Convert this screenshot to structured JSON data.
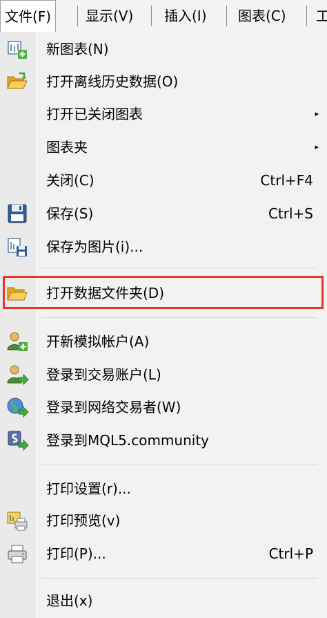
{
  "menubar": {
    "items": [
      "文件(F)",
      "显示(V)",
      "插入(I)",
      "图表(C)",
      "工"
    ]
  },
  "menu": {
    "items": [
      {
        "label": "新图表(N)",
        "icon": "new-chart-icon"
      },
      {
        "label": "打开离线历史数据(O)",
        "icon": "open-folder-icon"
      },
      {
        "label": "打开已关闭图表",
        "submenu": "▸"
      },
      {
        "label": "图表夹",
        "submenu": "▸"
      },
      {
        "label": "关闭(C)",
        "shortcut": "Ctrl+F4"
      },
      {
        "label": "保存(S)",
        "shortcut": "Ctrl+S",
        "icon": "floppy-disk-icon"
      },
      {
        "label": "保存为图片(i)...",
        "icon": "save-picture-icon"
      },
      {
        "label": "打开数据文件夹(D)",
        "icon": "folder-icon",
        "highlighted": true
      },
      {
        "label": "开新模拟帐户(A)",
        "icon": "user-add-icon"
      },
      {
        "label": "登录到交易账户(L)",
        "icon": "user-login-icon"
      },
      {
        "label": "登录到网络交易者(W)",
        "icon": "globe-login-icon"
      },
      {
        "label": "登录到MQL5.community",
        "icon": "mql5-login-icon"
      },
      {
        "label": "打印设置(r)..."
      },
      {
        "label": "打印预览(v)",
        "icon": "print-preview-icon"
      },
      {
        "label": "打印(P)...",
        "shortcut": "Ctrl+P",
        "icon": "printer-icon"
      },
      {
        "label": "退出(x)"
      }
    ]
  },
  "colors": {
    "highlight_border": "#e8342b",
    "menu_bg": "#f2f2f2",
    "gutter_bg": "#eaeaea"
  }
}
